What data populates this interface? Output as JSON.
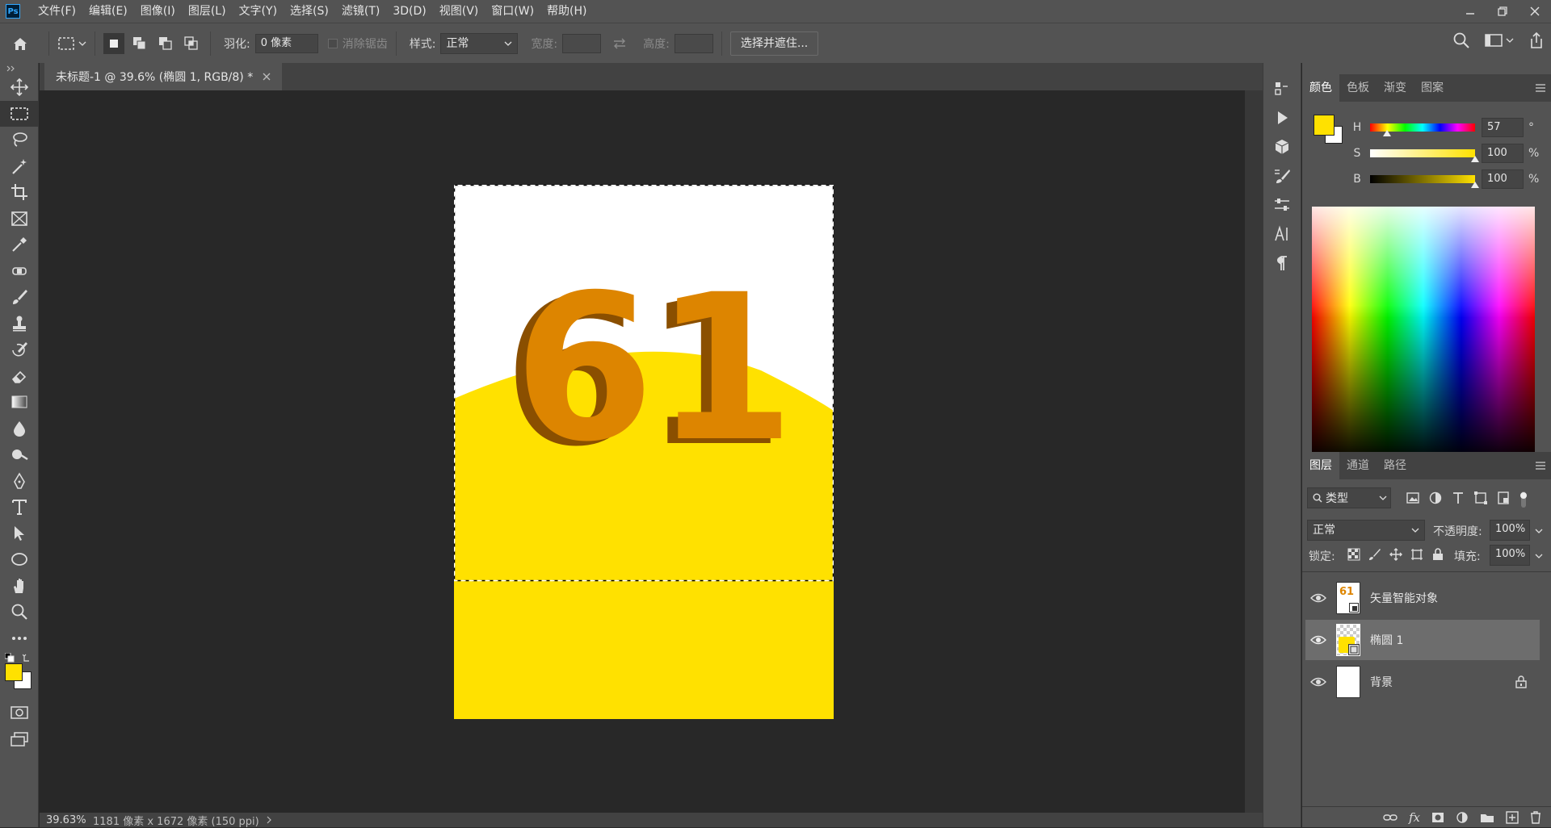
{
  "app": {
    "logo": "Ps"
  },
  "menu": [
    "文件(F)",
    "编辑(E)",
    "图像(I)",
    "图层(L)",
    "文字(Y)",
    "选择(S)",
    "滤镜(T)",
    "3D(D)",
    "视图(V)",
    "窗口(W)",
    "帮助(H)"
  ],
  "options": {
    "feather_label": "羽化:",
    "feather_value": "0 像素",
    "antialias_label": "消除锯齿",
    "style_label": "样式:",
    "style_value": "正常",
    "width_label": "宽度:",
    "height_label": "高度:",
    "select_mask_button": "选择并遮住..."
  },
  "document": {
    "tab_title": "未标题-1 @ 39.6% (椭圆 1, RGB/8) *",
    "canvas_text": "61",
    "colors": {
      "yellow": "#ffe100",
      "orange": "#dd8500",
      "white": "#ffffff"
    }
  },
  "status": {
    "zoom": "39.63%",
    "info": "1181 像素 x 1672 像素 (150 ppi)"
  },
  "color_panel": {
    "tabs": [
      "颜色",
      "色板",
      "渐变",
      "图案"
    ],
    "h_label": "H",
    "h_value": "57",
    "h_unit": "°",
    "h_level": 0.16,
    "s_label": "S",
    "s_value": "100",
    "s_unit": "%",
    "s_level": 1.0,
    "b_label": "B",
    "b_value": "100",
    "b_unit": "%",
    "b_level": 1.0,
    "foreground": "#ffe100",
    "background": "#ffffff"
  },
  "layers_panel": {
    "tabs": [
      "图层",
      "通道",
      "路径"
    ],
    "filter_value": "类型",
    "blend_mode": "正常",
    "opacity_label": "不透明度:",
    "opacity_value": "100%",
    "lock_label": "锁定:",
    "fill_label": "填充:",
    "fill_value": "100%",
    "layers": [
      {
        "name": "矢量智能对象"
      },
      {
        "name": "椭圆 1"
      },
      {
        "name": "背景"
      }
    ]
  }
}
